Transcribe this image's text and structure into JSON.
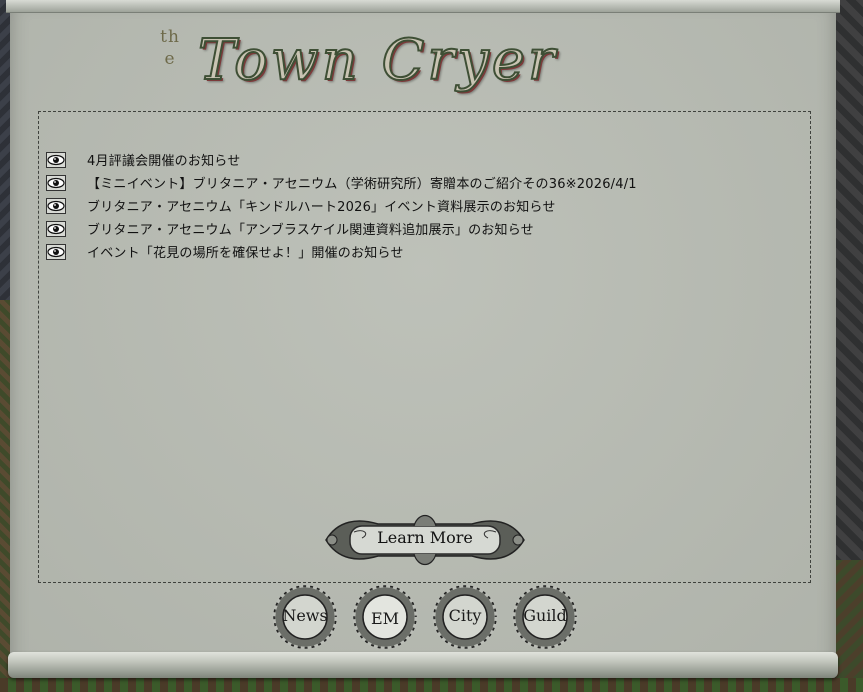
{
  "header": {
    "title_prefix": "the",
    "title": "Town Cryer"
  },
  "news": {
    "items": [
      {
        "icon": "eye-icon",
        "label": "4月評議会開催のお知らせ"
      },
      {
        "icon": "eye-icon",
        "label": "【ミニイベント】ブリタニア・アセニウム（学術研究所）寄贈本のご紹介その36※2026/4/1"
      },
      {
        "icon": "eye-icon",
        "label": "ブリタニア・アセニウム「キンドルハート2026」イベント資料展示のお知らせ"
      },
      {
        "icon": "eye-icon",
        "label": "ブリタニア・アセニウム「アンブラスケイル関連資料追加展示」のお知らせ"
      },
      {
        "icon": "eye-icon",
        "label": "イベント「花見の場所を確保せよ！」開催のお知らせ"
      }
    ]
  },
  "actions": {
    "learn_more_label": "Learn More"
  },
  "tabs": [
    {
      "label": "News"
    },
    {
      "label": "EM"
    },
    {
      "label": "City"
    },
    {
      "label": "Guild"
    }
  ]
}
